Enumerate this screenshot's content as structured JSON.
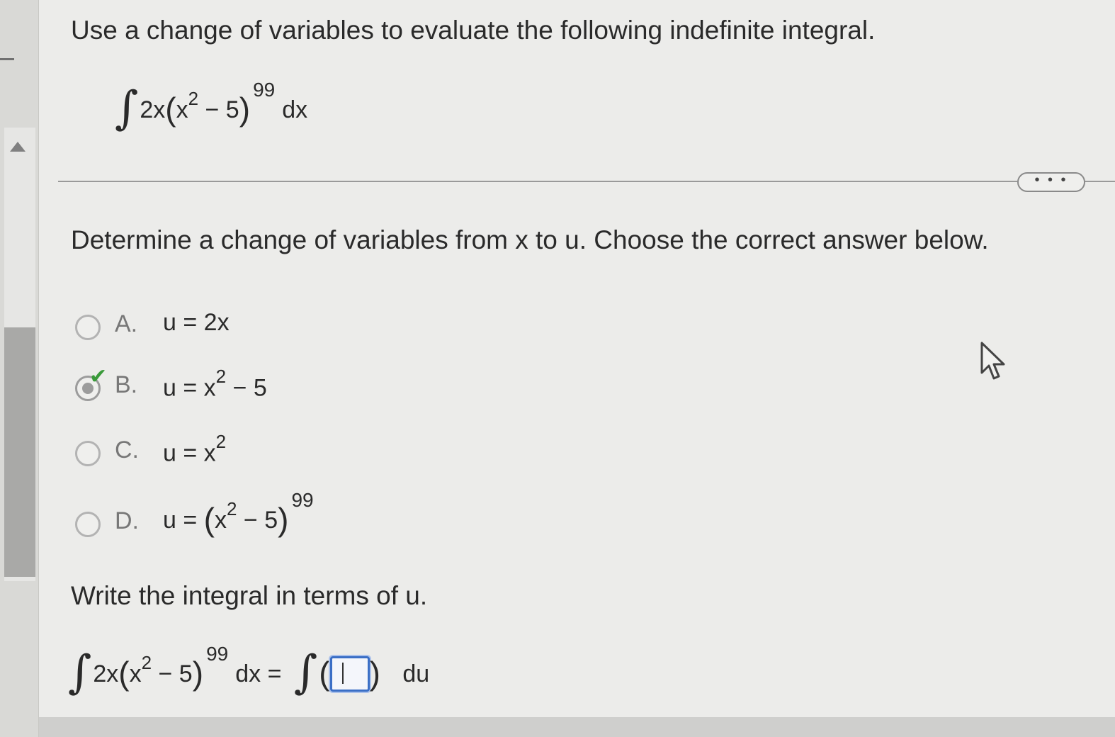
{
  "question": {
    "prompt": "Use a change of variables to evaluate the following indefinite integral.",
    "integral": {
      "integral_sign": "∫",
      "coefficient": "2x",
      "open_paren": "(",
      "base": "x",
      "inner_exponent": "2",
      "inner_rest": " − 5",
      "close_paren": ")",
      "outer_exponent": "99",
      "differential": "dx"
    }
  },
  "more_button": {
    "label": "• • •"
  },
  "part1": {
    "instruction": "Determine a change of variables from x to u. Choose the correct answer below.",
    "options": [
      {
        "letter": "A.",
        "expr_prefix": "u = 2x",
        "selected": false
      },
      {
        "letter": "B.",
        "expr_prefix": "u = x",
        "sup": "2",
        "expr_suffix": " − 5",
        "selected": true,
        "correct": true
      },
      {
        "letter": "C.",
        "expr_prefix": "u = x",
        "sup": "2",
        "selected": false
      },
      {
        "letter": "D.",
        "expr_prefix": "u = ",
        "open_paren": "(",
        "base": "x",
        "sup": "2",
        "expr_suffix": " − 5",
        "close_paren": ")",
        "outer_exponent": "99",
        "selected": false
      }
    ],
    "check_icon": "checkmark-icon"
  },
  "part2": {
    "instruction": "Write the integral in terms of u.",
    "lhs": {
      "integral_sign": "∫",
      "coefficient": "2x",
      "open_paren": "(",
      "base": "x",
      "inner_exponent": "2",
      "inner_rest": " − 5",
      "close_paren": ")",
      "outer_exponent": "99",
      "differential": "dx ="
    },
    "rhs": {
      "integral_sign": "∫",
      "open_paren": "(",
      "answer_value": "",
      "close_paren": ")",
      "differential": "du"
    }
  },
  "colors": {
    "accent": "#3b6fc6",
    "check": "#3a9a3a",
    "background": "#ececea"
  }
}
